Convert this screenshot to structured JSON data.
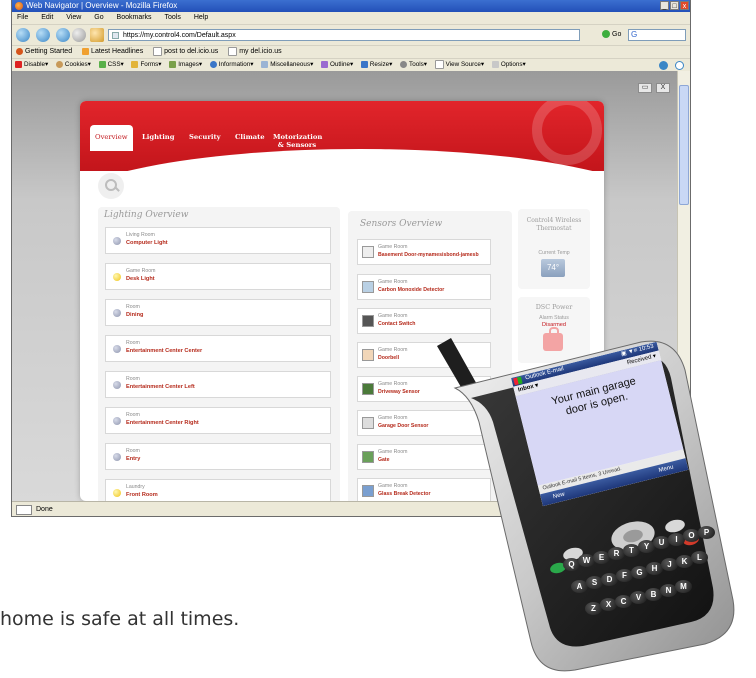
{
  "browser": {
    "window_title": "Web Navigator | Overview - Mozilla Firefox",
    "window_controls": [
      "_",
      "□",
      "x"
    ],
    "menu": [
      "File",
      "Edit",
      "View",
      "Go",
      "Bookmarks",
      "Tools",
      "Help"
    ],
    "url": "https://my.control4.com/Default.aspx",
    "go_label": "Go",
    "search_glyph": "G",
    "bookmarks": [
      "Getting Started",
      "Latest Headlines",
      "post to del.icio.us",
      "my del.icio.us"
    ],
    "dev_toolbar": [
      "Disable▾",
      "Cookies▾",
      "CSS▾",
      "Forms▾",
      "Images▾",
      "Information▾",
      "Miscellaneous▾",
      "Outline▾",
      "Resize▾",
      "Tools▾",
      "View Source▾",
      "Options▾"
    ],
    "content_controls": [
      "▭",
      "X"
    ],
    "status": "Done"
  },
  "c4": {
    "tabs": [
      "Overview",
      "Lighting",
      "Security",
      "Climate",
      "Motorization & Sensors"
    ],
    "lighting_title": "Lighting Overview",
    "sensors_title": "Sensors Overview",
    "lights": [
      {
        "room": "Living Room",
        "device": "Computer Light",
        "on": false
      },
      {
        "room": "Game Room",
        "device": "Desk Light",
        "on": true
      },
      {
        "room": "Room",
        "device": "Dining",
        "on": false
      },
      {
        "room": "Room",
        "device": "Entertainment Center Center",
        "on": false
      },
      {
        "room": "Room",
        "device": "Entertainment Center Left",
        "on": false
      },
      {
        "room": "Room",
        "device": "Entertainment Center Right",
        "on": false
      },
      {
        "room": "Room",
        "device": "Entry",
        "on": false
      },
      {
        "room": "Laundry",
        "device": "Front Room",
        "on": true
      }
    ],
    "sensors": [
      {
        "room": "Game Room",
        "device": "Basement Door-mynamesisbond-jamesb"
      },
      {
        "room": "Game Room",
        "device": "Carbon Monoxide Detector"
      },
      {
        "room": "Game Room",
        "device": "Contact Switch"
      },
      {
        "room": "Game Room",
        "device": "Doorbell"
      },
      {
        "room": "Game Room",
        "device": "Driveway Sensor"
      },
      {
        "room": "Game Room",
        "device": "Garage Door Sensor"
      },
      {
        "room": "Game Room",
        "device": "Gate"
      },
      {
        "room": "Game Room",
        "device": "Glass Break Detector"
      }
    ],
    "thermostat": {
      "title": "Control4 Wireless Thermostat",
      "label": "Current Temp",
      "value": "74°"
    },
    "dsc": {
      "title": "DSC Power",
      "label": "Alarm Status",
      "value": "Disarmed"
    }
  },
  "phone": {
    "app_title": "Outlook E-mail",
    "status_icons": "▣ ▼≡ 10:53",
    "folder": "Inbox ▾",
    "sort": "Received ▾",
    "message": "Your main garage door is open.",
    "summary": "Outlook E-mail 5 Items, 3 Unread.",
    "soft_left": "New",
    "soft_right": "Menu",
    "keys": [
      "Q",
      "W",
      "E",
      "R",
      "T",
      "Y",
      "U",
      "I",
      "O",
      "P",
      "A",
      "S",
      "D",
      "F",
      "G",
      "H",
      "J",
      "K",
      "L",
      "Z",
      "X",
      "C",
      "V",
      "B",
      "N",
      "M"
    ]
  },
  "caption": "home is safe at all times."
}
